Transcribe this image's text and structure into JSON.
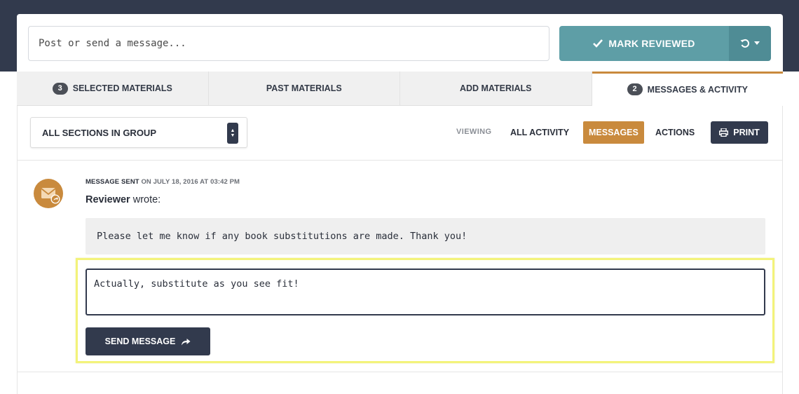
{
  "composer": {
    "placeholder": "Post or send a message...",
    "mark_reviewed_label": "MARK REVIEWED",
    "mark_reviewed_icon": "check-icon",
    "dropdown_icon": "undo-icon"
  },
  "tabs": [
    {
      "label": "SELECTED MATERIALS",
      "badge": "3",
      "active": false
    },
    {
      "label": "PAST MATERIALS",
      "badge": null,
      "active": false
    },
    {
      "label": "ADD MATERIALS",
      "badge": null,
      "active": false
    },
    {
      "label": "MESSAGES & ACTIVITY",
      "badge": "2",
      "active": true
    }
  ],
  "filters": {
    "section_select": "ALL SECTIONS IN GROUP",
    "viewing_label": "VIEWING",
    "all_activity": "ALL ACTIVITY",
    "messages": "MESSAGES",
    "actions": "ACTIONS",
    "print": "PRINT"
  },
  "message": {
    "event": "MESSAGE SENT",
    "date_text": "ON JULY 18, 2016 AT 03:42 PM",
    "author": "Reviewer",
    "wrote_suffix": "wrote:",
    "body": "Please let me know if any book substitutions are made. Thank you!"
  },
  "reply": {
    "value": "Actually, substitute as you see fit!",
    "send_label": "SEND MESSAGE"
  },
  "colors": {
    "navy": "#323a4d",
    "teal": "#5e9ea6",
    "accent": "#c98a3d",
    "highlight": "#f3f37a"
  }
}
